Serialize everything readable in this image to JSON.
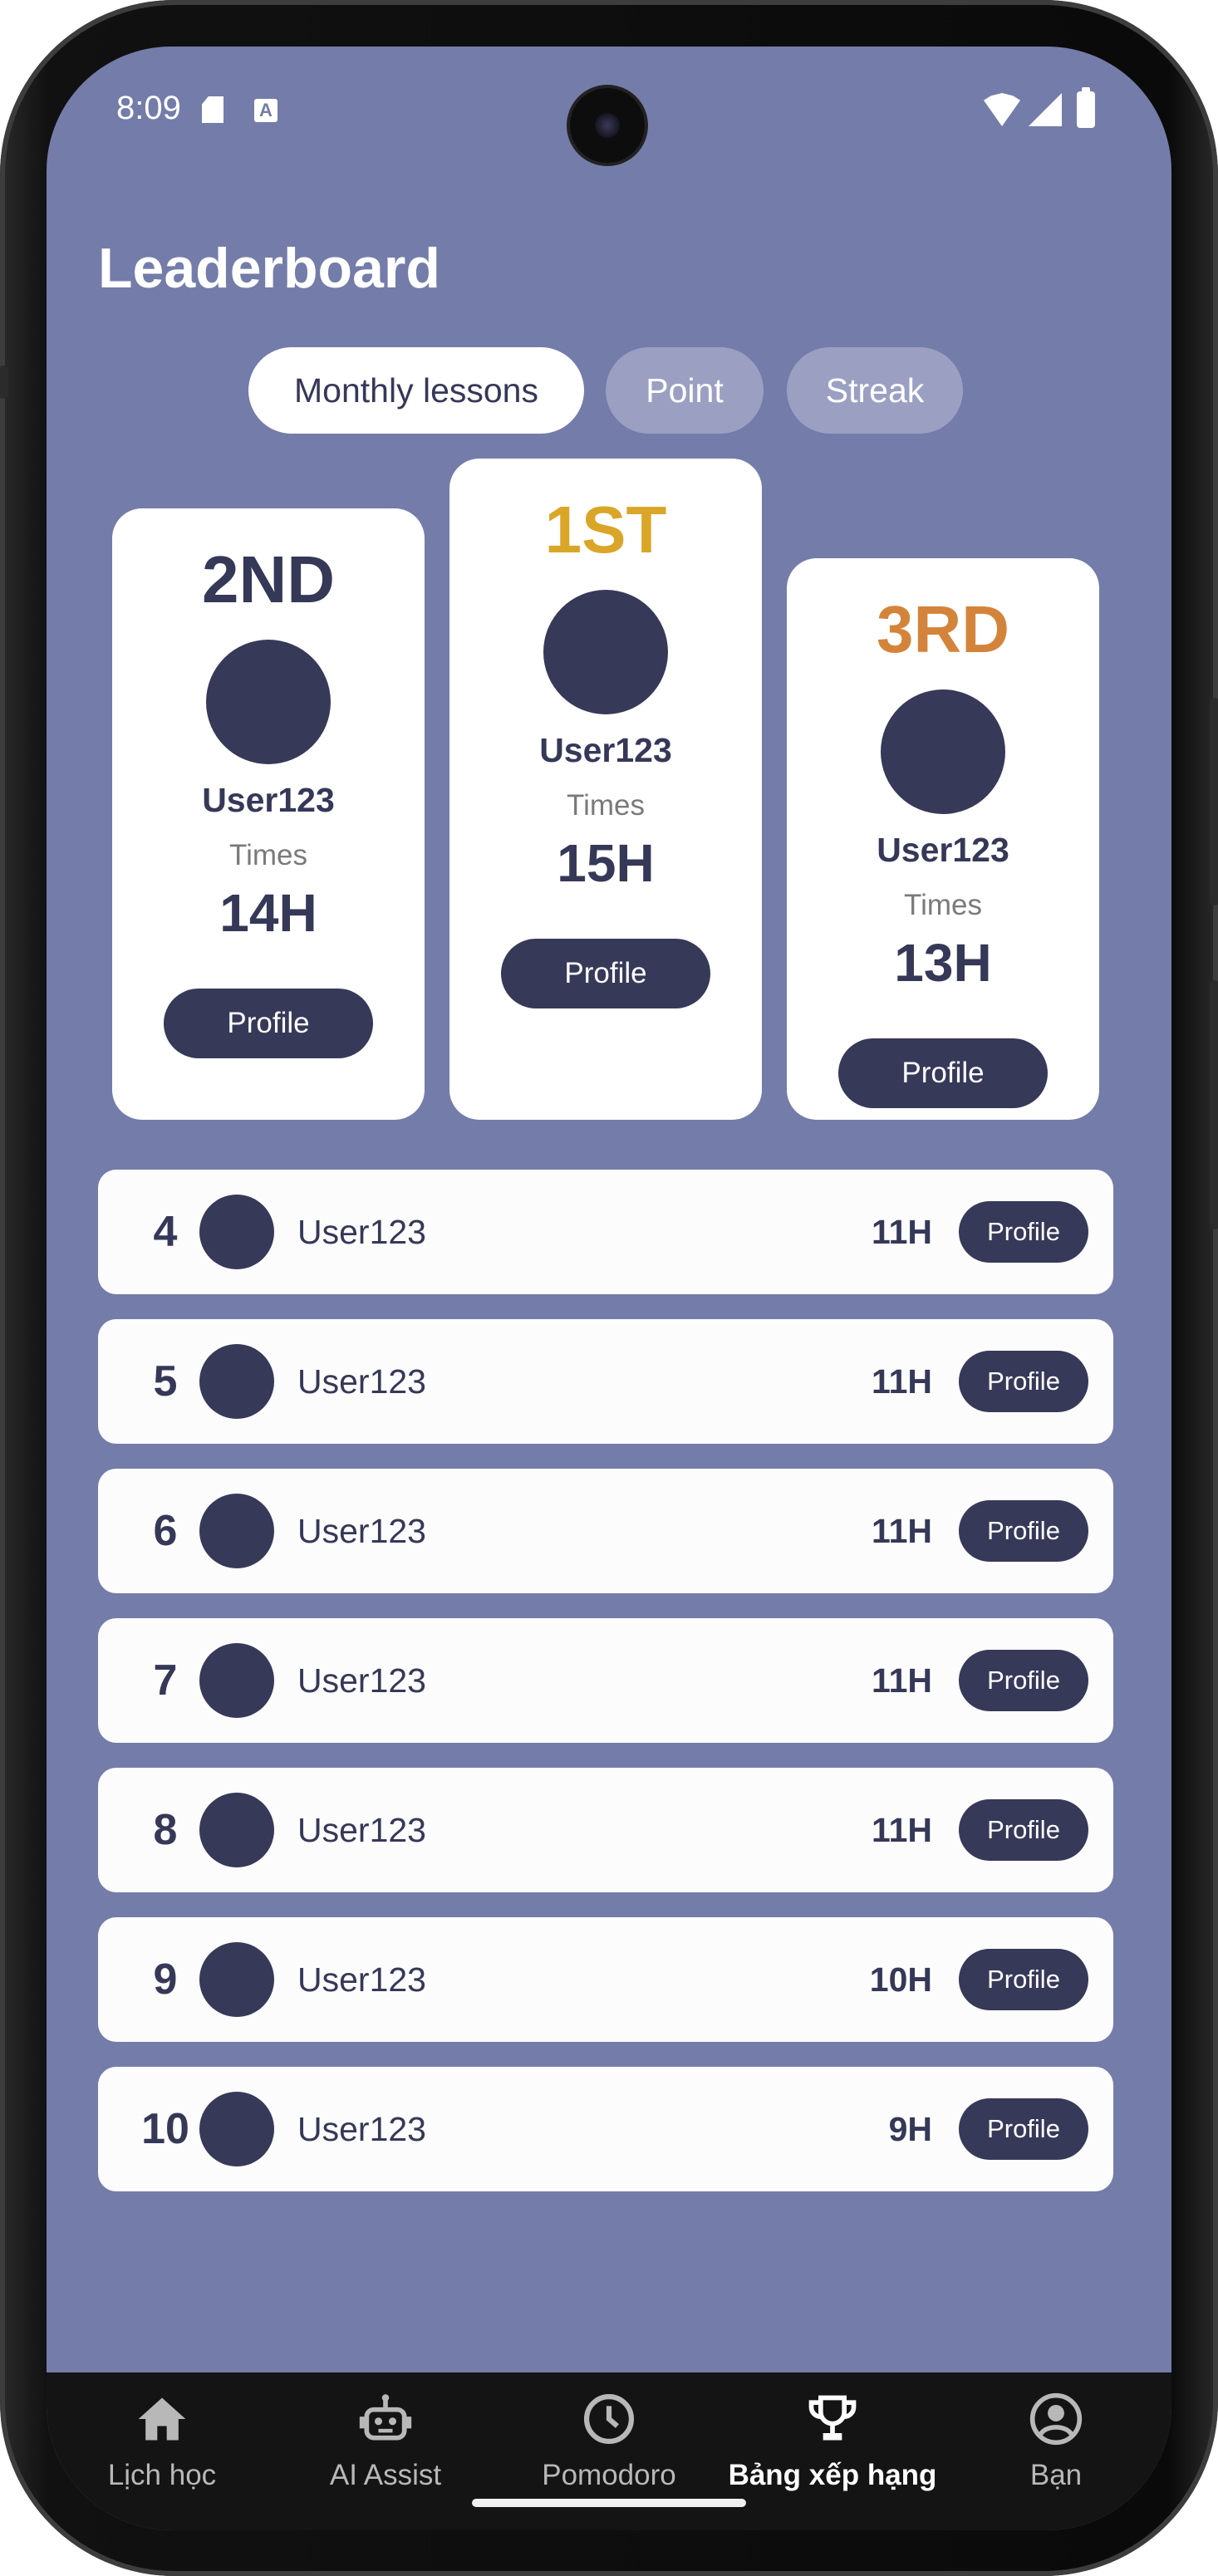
{
  "status_bar": {
    "time": "8:09"
  },
  "header": {
    "title": "Leaderboard"
  },
  "tabs": [
    {
      "label": "Monthly lessons",
      "active": true
    },
    {
      "label": "Point",
      "active": false
    },
    {
      "label": "Streak",
      "active": false
    }
  ],
  "podium": {
    "first": {
      "rank": "1ST",
      "rank_color": "#d9a628",
      "name": "User123",
      "label": "Times",
      "value": "15H",
      "button": "Profile"
    },
    "second": {
      "rank": "2ND",
      "rank_color": "#363858",
      "name": "User123",
      "label": "Times",
      "value": "14H",
      "button": "Profile"
    },
    "third": {
      "rank": "3RD",
      "rank_color": "#d4843a",
      "name": "User123",
      "label": "Times",
      "value": "13H",
      "button": "Profile"
    }
  },
  "list": [
    {
      "rank": "4",
      "name": "User123",
      "value": "11H",
      "button": "Profile"
    },
    {
      "rank": "5",
      "name": "User123",
      "value": "11H",
      "button": "Profile"
    },
    {
      "rank": "6",
      "name": "User123",
      "value": "11H",
      "button": "Profile"
    },
    {
      "rank": "7",
      "name": "User123",
      "value": "11H",
      "button": "Profile"
    },
    {
      "rank": "8",
      "name": "User123",
      "value": "11H",
      "button": "Profile"
    },
    {
      "rank": "9",
      "name": "User123",
      "value": "10H",
      "button": "Profile"
    },
    {
      "rank": "10",
      "name": "User123",
      "value": "9H",
      "button": "Profile"
    }
  ],
  "bottom_nav": [
    {
      "label": "Lịch học",
      "icon": "home-icon",
      "active": false
    },
    {
      "label": "AI Assist",
      "icon": "robot-icon",
      "active": false
    },
    {
      "label": "Pomodoro",
      "icon": "clock-icon",
      "active": false
    },
    {
      "label": "Bảng xếp hạng",
      "icon": "trophy-icon",
      "active": true
    },
    {
      "label": "Bạn",
      "icon": "account-icon",
      "active": false
    }
  ],
  "colors": {
    "background": "#747ca9",
    "accent_dark": "#373959",
    "gold": "#d9a628",
    "bronze": "#d4843a"
  }
}
